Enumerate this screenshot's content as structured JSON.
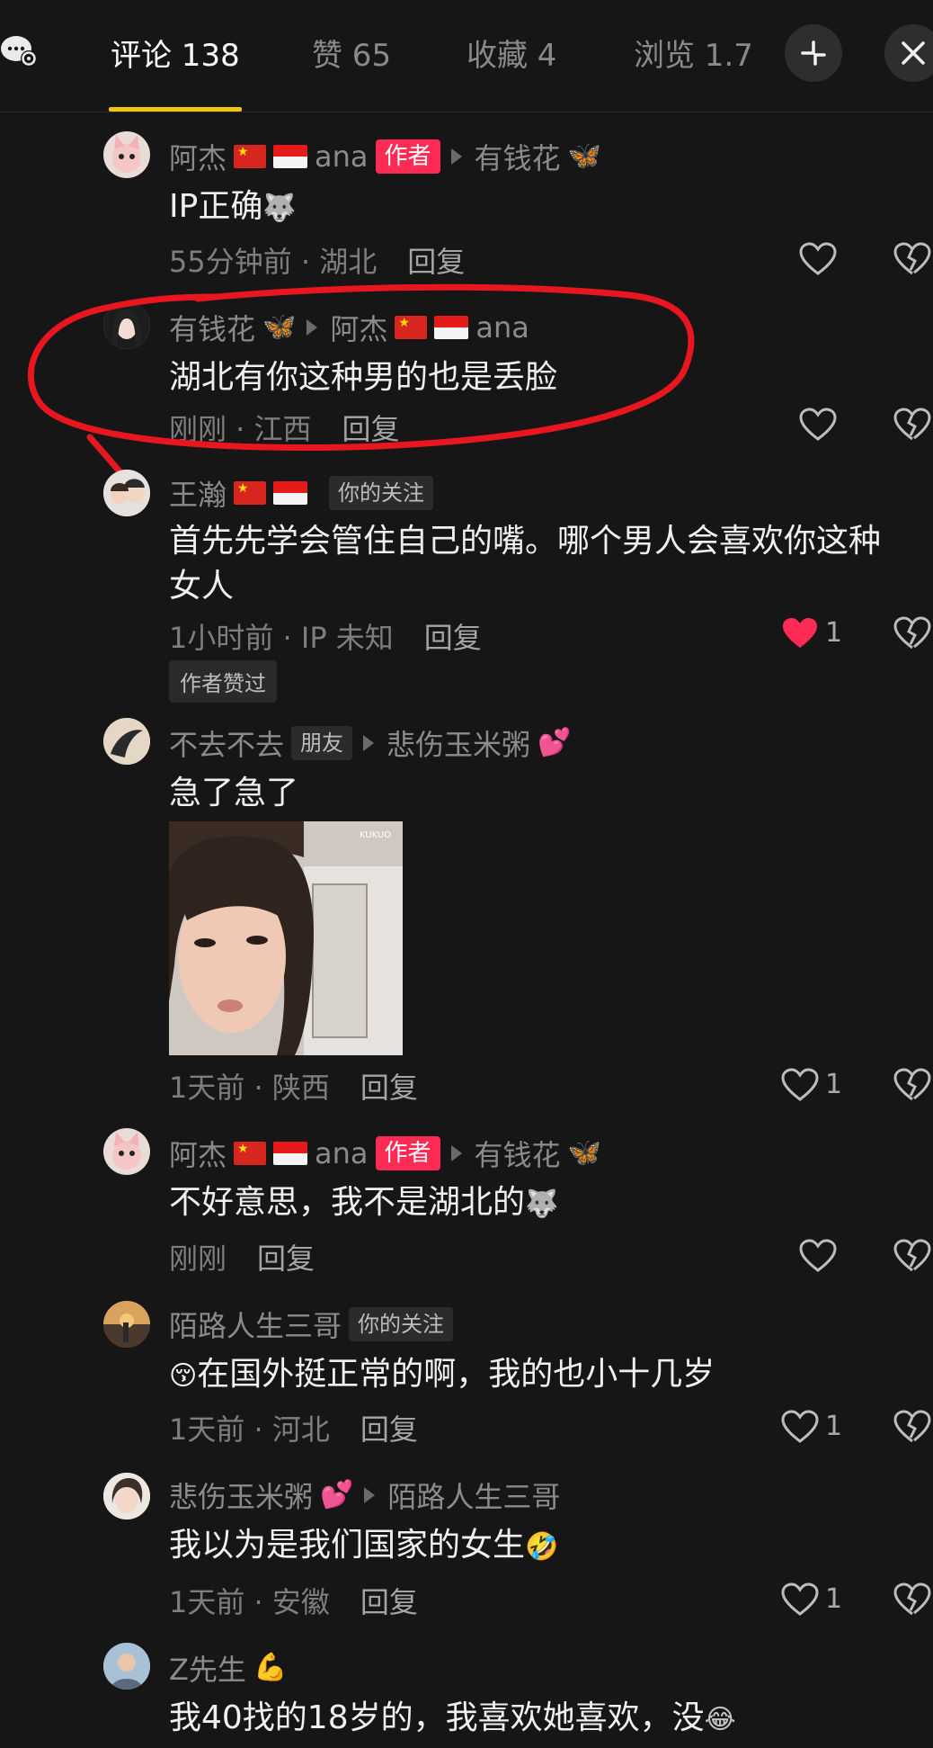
{
  "tabs": [
    {
      "label": "评论 138",
      "active": true
    },
    {
      "label": "赞 65",
      "active": false
    },
    {
      "label": "收藏 4",
      "active": false
    },
    {
      "label": "浏览 1.7",
      "active": false
    }
  ],
  "colors": {
    "accent": "#f2c419",
    "author_badge": "#fe2c55",
    "liked_heart": "#fe2c55",
    "highlight_ring": "#e8161f"
  },
  "comments": [
    {
      "name": "阿杰",
      "after_flags": "ana",
      "badge": "作者",
      "reply_to": "有钱花",
      "text": "IP正确",
      "time_loc": "55分钟前 · 湖北",
      "reply": "回复"
    },
    {
      "name": "有钱花",
      "reply_to": "阿杰",
      "after_flags": "ana",
      "text": "湖北有你这种男的也是丢脸",
      "time_loc": "刚刚 · 江西",
      "reply": "回复"
    },
    {
      "name": "王瀚",
      "badge": "你的关注",
      "text_line1": "首先先学会管住自己的嘴。哪个男人会喜欢你这种",
      "text_line2": "女人",
      "time_loc": "1小时前 · IP 未知",
      "reply": "回复",
      "likes": "1",
      "liked_tag": "作者赞过"
    },
    {
      "name": "不去不去",
      "badge": "朋友",
      "reply_to": "悲伤玉米粥",
      "text": "急了急了",
      "image_watermark": "KUKUO",
      "time_loc": "1天前 · 陕西",
      "reply": "回复",
      "likes": "1"
    },
    {
      "name": "阿杰",
      "after_flags": "ana",
      "badge": "作者",
      "reply_to": "有钱花",
      "text": "不好意思，我不是湖北的",
      "time_loc": "刚刚",
      "reply": "回复"
    },
    {
      "name": "陌路人生三哥",
      "badge": "你的关注",
      "text": "在国外挺正常的啊，我的也小十几岁",
      "time_loc": "1天前 · 河北",
      "reply": "回复",
      "likes": "1"
    },
    {
      "name": "悲伤玉米粥",
      "reply_to": "陌路人生三哥",
      "text": "我以为是我们国家的女生",
      "time_loc": "1天前 · 安徽",
      "reply": "回复",
      "likes": "1"
    },
    {
      "name": "Z先生",
      "text": "我40找的18岁的，我喜欢她喜欢，没"
    }
  ]
}
